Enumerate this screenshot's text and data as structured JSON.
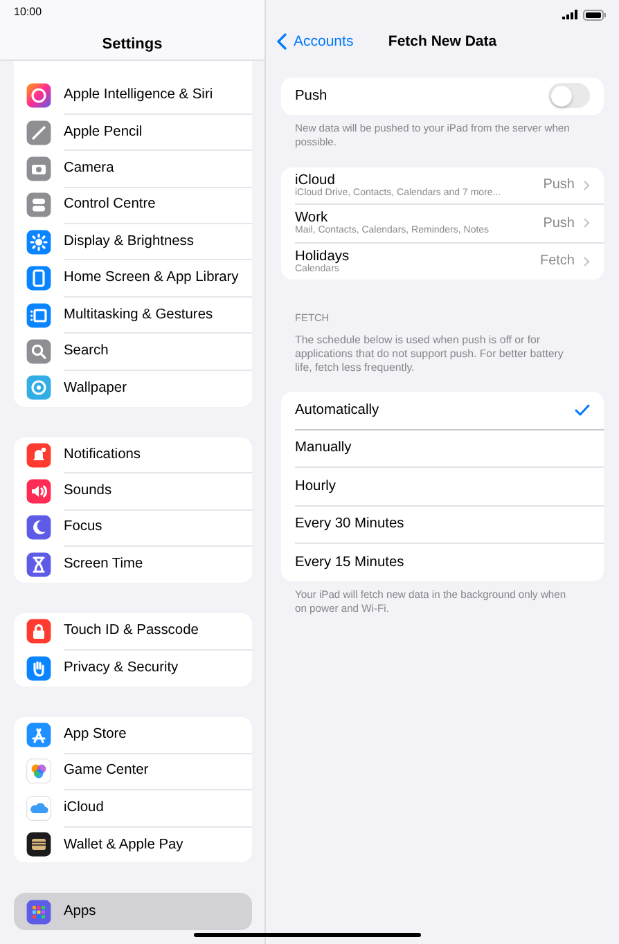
{
  "status_bar": {
    "time": "10:00"
  },
  "sidebar": {
    "title": "Settings",
    "groups": [
      {
        "items": [
          {
            "label": "Apple Intelligence & Siri",
            "selected": false
          },
          {
            "label": "Apple Pencil",
            "selected": false
          },
          {
            "label": "Camera",
            "selected": false
          },
          {
            "label": "Control Centre",
            "selected": false
          },
          {
            "label": "Display & Brightness",
            "selected": false
          },
          {
            "label": "Home Screen & App Library",
            "selected": false
          },
          {
            "label": "Multitasking & Gestures",
            "selected": false
          },
          {
            "label": "Search",
            "selected": false
          },
          {
            "label": "Wallpaper",
            "selected": false
          }
        ]
      },
      {
        "items": [
          {
            "label": "Notifications",
            "selected": false
          },
          {
            "label": "Sounds",
            "selected": false
          },
          {
            "label": "Focus",
            "selected": false
          },
          {
            "label": "Screen Time",
            "selected": false
          }
        ]
      },
      {
        "items": [
          {
            "label": "Touch ID & Passcode",
            "selected": false
          },
          {
            "label": "Privacy & Security",
            "selected": false
          }
        ]
      },
      {
        "items": [
          {
            "label": "App Store",
            "selected": false
          },
          {
            "label": "Game Center",
            "selected": false
          },
          {
            "label": "iCloud",
            "selected": false
          },
          {
            "label": "Wallet & Apple Pay",
            "selected": false
          }
        ]
      },
      {
        "items": [
          {
            "label": "Apps",
            "selected": true
          }
        ]
      }
    ]
  },
  "detail": {
    "back": "Accounts",
    "title": "Fetch New Data",
    "push": {
      "label": "Push",
      "on": false,
      "footer": "New data will be pushed to your iPad from the server when possible."
    },
    "accounts": [
      {
        "name": "iCloud",
        "detail": "iCloud Drive, Contacts, Calendars and 7 more...",
        "value": "Push"
      },
      {
        "name": "Work",
        "detail": "Mail, Contacts, Calendars, Reminders, Notes",
        "value": "Push"
      },
      {
        "name": "Holidays",
        "detail": "Calendars",
        "value": "Fetch"
      }
    ],
    "fetch": {
      "header": "FETCH",
      "description": "The schedule below is used when push is off or for applications that do not support push. For better battery life, fetch less frequently.",
      "options": [
        {
          "label": "Automatically",
          "selected": true
        },
        {
          "label": "Manually",
          "selected": false
        },
        {
          "label": "Hourly",
          "selected": false
        },
        {
          "label": "Every 30 Minutes",
          "selected": false
        },
        {
          "label": "Every 15 Minutes",
          "selected": false
        }
      ],
      "footer": "Your iPad will fetch new data in the background only when on power and Wi-Fi."
    }
  }
}
